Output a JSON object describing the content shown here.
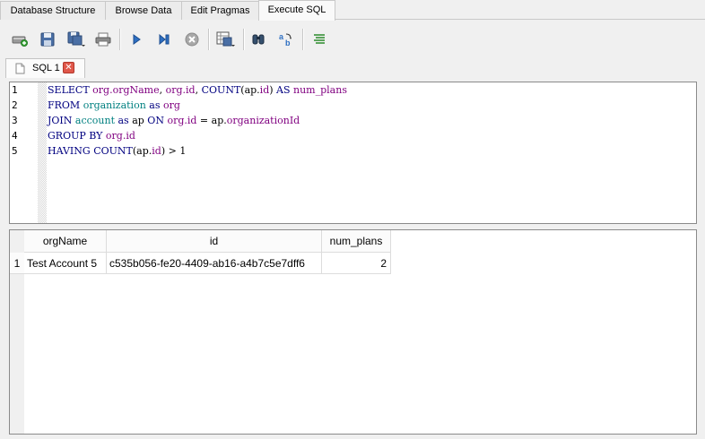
{
  "main_tabs": [
    {
      "label": "Database Structure",
      "active": false
    },
    {
      "label": "Browse Data",
      "active": false
    },
    {
      "label": "Edit Pragmas",
      "active": false
    },
    {
      "label": "Execute SQL",
      "active": true
    }
  ],
  "toolbar": {
    "buttons": [
      "open-tab-icon",
      "open-sql-file-icon",
      "save-sql-file-icon",
      "print-icon",
      "execute-all-icon",
      "execute-line-icon",
      "stop-icon",
      "save-results-icon",
      "find-icon",
      "find-replace-icon",
      "comment-icon"
    ]
  },
  "editor_tab": {
    "label": "SQL 1",
    "close": "✕"
  },
  "editor": {
    "line_numbers": [
      "1",
      "2",
      "3",
      "4",
      "5"
    ]
  },
  "results": {
    "columns": [
      "orgName",
      "id",
      "num_plans"
    ],
    "rows": [
      {
        "num": "1",
        "orgName": "Test Account 5",
        "id": "c535b056-fe20-4409-ab16-a4b7c5e7dff6",
        "num_plans": "2"
      }
    ]
  }
}
